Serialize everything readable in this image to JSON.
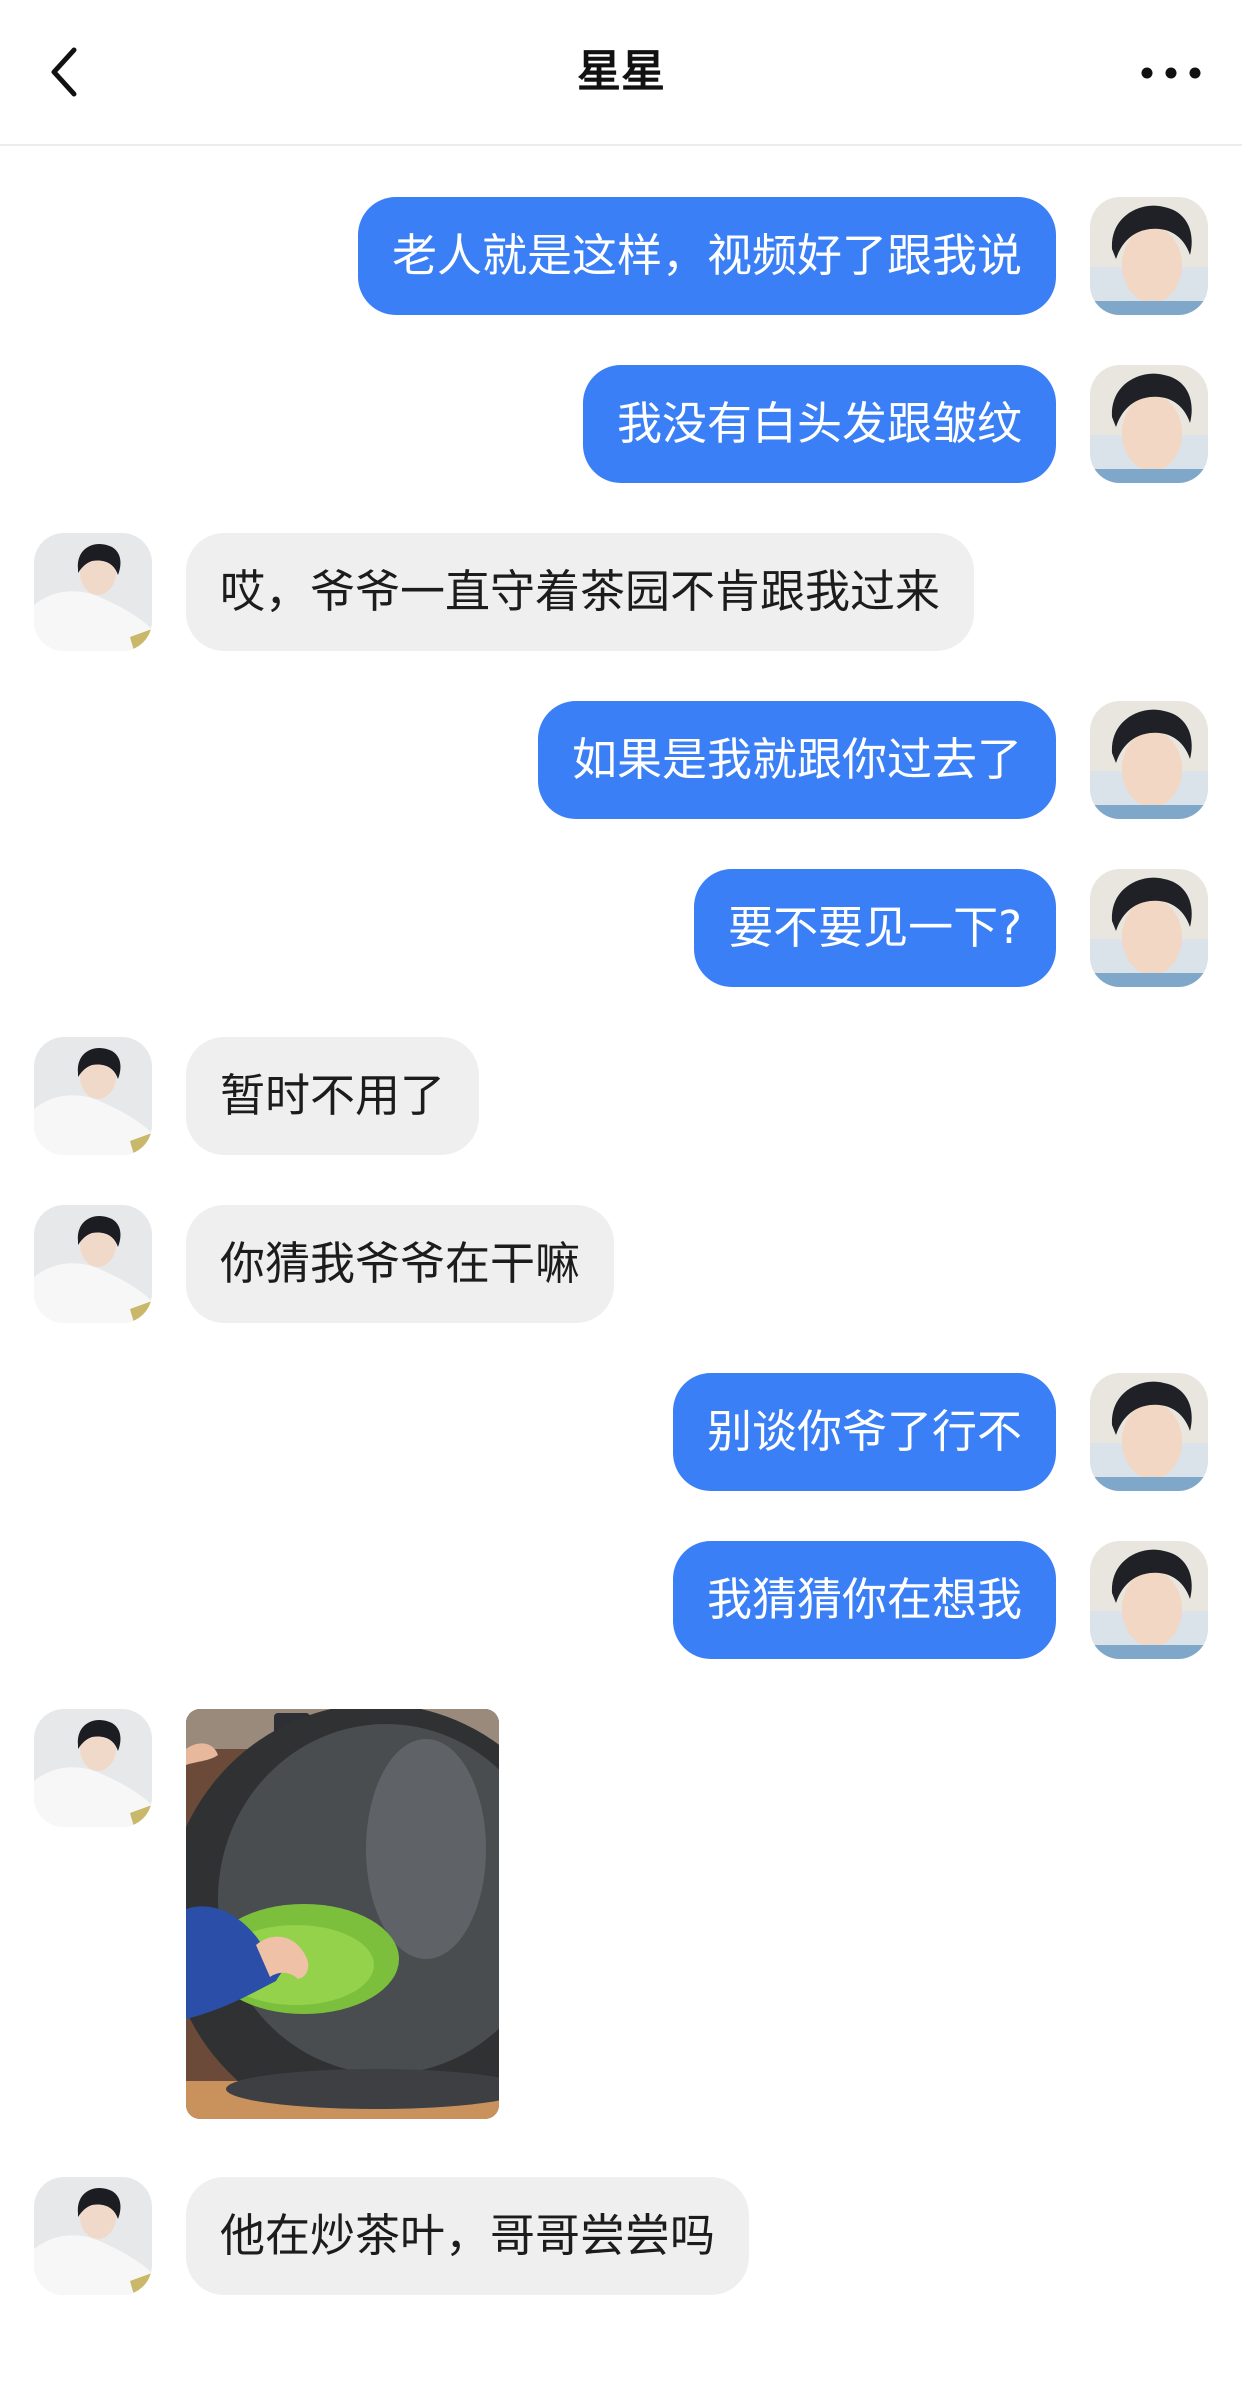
{
  "header": {
    "title": "星星"
  },
  "messages": [
    {
      "side": "me",
      "text": "老人就是这样，视频好了跟我说"
    },
    {
      "side": "me",
      "text": "我没有白头发跟皱纹"
    },
    {
      "side": "them",
      "text": "哎，爷爷一直守着茶园不肯跟我过来"
    },
    {
      "side": "me",
      "text": "如果是我就跟你过去了"
    },
    {
      "side": "me",
      "text": "要不要见一下?"
    },
    {
      "side": "them",
      "text": "暂时不用了"
    },
    {
      "side": "them",
      "text": "你猜我爷爷在干嘛"
    },
    {
      "side": "me",
      "text": "别谈你爷了行不"
    },
    {
      "side": "me",
      "text": "我猜猜你在想我"
    },
    {
      "side": "them",
      "type": "image",
      "image": "tea-leaves-in-wok-photo"
    },
    {
      "side": "them",
      "text": "他在炒茶叶，哥哥尝尝吗"
    }
  ],
  "colors": {
    "outgoing_bubble": "#3a7ff6",
    "incoming_bubble": "#efefef",
    "outgoing_text": "#ffffff",
    "incoming_text": "#1c1c1c"
  },
  "icons": {
    "back": "chevron-left-icon",
    "more": "more-dots-icon"
  }
}
